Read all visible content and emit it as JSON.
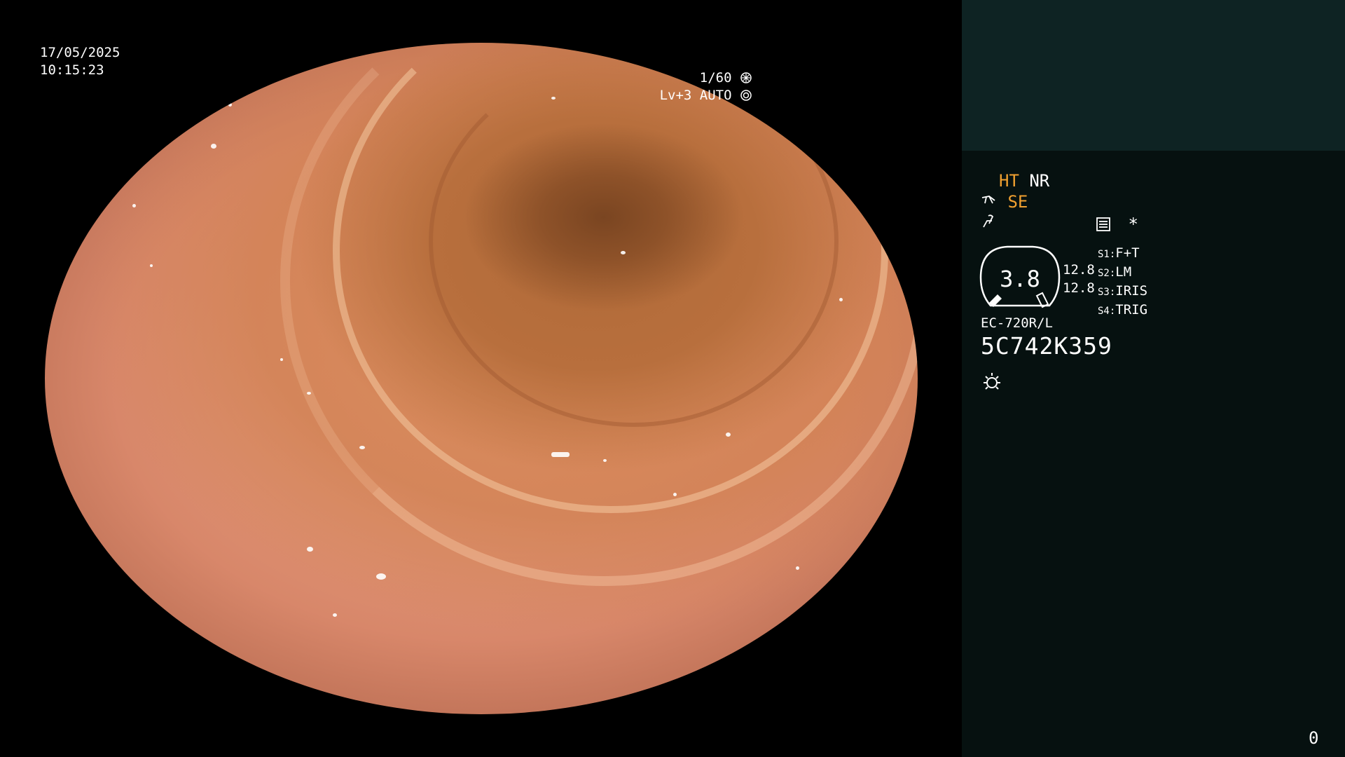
{
  "overlay": {
    "date": "17/05/2025",
    "time": "10:15:23",
    "shutter": "1/60",
    "level": "Lv+3 AUTO"
  },
  "panel": {
    "ht": "HT",
    "nr": "NR",
    "se": "SE",
    "zoom_value": "3.8",
    "val_1": "12.8",
    "val_2": "12.8",
    "switches": [
      {
        "tag": "S1:",
        "value": "F+T"
      },
      {
        "tag": "S2:",
        "value": "LM"
      },
      {
        "tag": "S3:",
        "value": "IRIS"
      },
      {
        "tag": "S4:",
        "value": "TRIG"
      }
    ],
    "asterisk": "*",
    "model": "EC-720R/L",
    "serial": "5C742K359",
    "counter": "0"
  },
  "colors": {
    "accent_orange": "#f0a030",
    "panel_bg": "#061110",
    "panel_top_bg": "#0e2323"
  },
  "icons": [
    "aperture-icon",
    "iris-icon",
    "scope-icon",
    "enhance-icon",
    "settings-list-icon",
    "light-icon"
  ]
}
